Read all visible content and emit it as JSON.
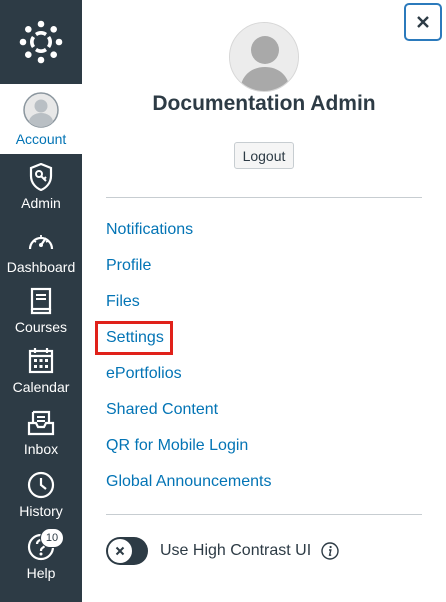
{
  "nav": {
    "logo_icon": "canvas-logo-icon",
    "items": [
      {
        "label": "Account",
        "icon": "avatar-icon",
        "active": true
      },
      {
        "label": "Admin",
        "icon": "shield-icon"
      },
      {
        "label": "Dashboard",
        "icon": "gauge-icon"
      },
      {
        "label": "Courses",
        "icon": "book-icon"
      },
      {
        "label": "Calendar",
        "icon": "calendar-icon"
      },
      {
        "label": "Inbox",
        "icon": "inbox-icon"
      },
      {
        "label": "History",
        "icon": "clock-icon"
      },
      {
        "label": "Help",
        "icon": "help-icon",
        "badge": "10"
      }
    ]
  },
  "tray": {
    "user_name": "Documentation Admin",
    "logout_label": "Logout",
    "close_icon": "close-icon",
    "links": [
      {
        "label": "Notifications"
      },
      {
        "label": "Profile"
      },
      {
        "label": "Files"
      },
      {
        "label": "Settings",
        "highlighted": true
      },
      {
        "label": "ePortfolios"
      },
      {
        "label": "Shared Content"
      },
      {
        "label": "QR for Mobile Login"
      },
      {
        "label": "Global Announcements"
      }
    ],
    "high_contrast_label": "Use High Contrast UI",
    "high_contrast_on": false
  },
  "colors": {
    "nav_bg": "#2d3b45",
    "link": "#0374b5",
    "highlight_outline": "#e0211a"
  }
}
